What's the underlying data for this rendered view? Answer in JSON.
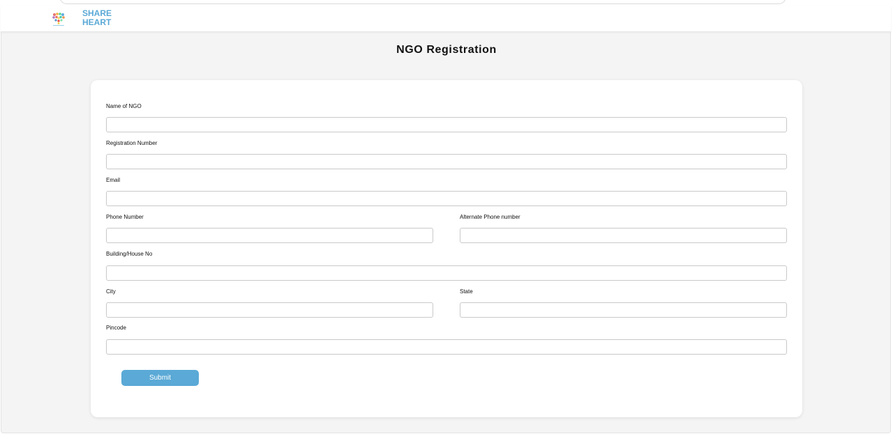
{
  "brand": {
    "line1": "SHARE",
    "line2": "HEART",
    "logo_icon": "heart-logo-icon"
  },
  "page": {
    "title": "NGO Registration"
  },
  "form": {
    "name_of_ngo": {
      "label": "Name of NGO",
      "value": "",
      "placeholder": ""
    },
    "registration_number": {
      "label": "Registration Number",
      "value": "",
      "placeholder": ""
    },
    "email": {
      "label": "Email",
      "value": "",
      "placeholder": ""
    },
    "phone_number": {
      "label": "Phone Number",
      "value": "",
      "placeholder": ""
    },
    "alternate_phone": {
      "label": "Alternate Phone number",
      "value": "",
      "placeholder": ""
    },
    "building": {
      "label": "Building/House No",
      "value": "",
      "placeholder": ""
    },
    "city": {
      "label": "City",
      "value": "",
      "placeholder": ""
    },
    "state": {
      "label": "State",
      "value": "",
      "placeholder": ""
    },
    "pincode": {
      "label": "Pincode",
      "value": "",
      "placeholder": ""
    },
    "submit_label": "Submit"
  },
  "colors": {
    "accent": "#5aa9d6",
    "background": "#f4f4f4",
    "card": "#ffffff"
  }
}
